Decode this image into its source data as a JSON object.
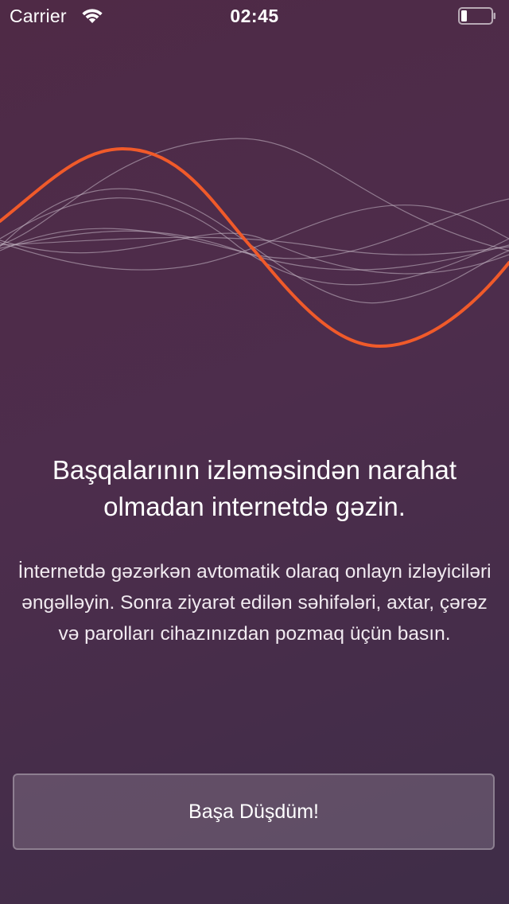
{
  "status_bar": {
    "carrier": "Carrier",
    "time": "02:45",
    "icons": {
      "wifi": "wifi-icon",
      "battery": "battery-icon"
    }
  },
  "illustration": {
    "icon": "sound-wave-icon",
    "accent_color": "#f05a2a",
    "line_color": "#c8bcc8"
  },
  "onboarding": {
    "headline": "Başqalarının izləməsindən narahat olmadan internetdə gəzin.",
    "body": "İnternetdə gəzərkən avtomatik olaraq onlayn izləyiciləri əngəlləyin. Sonra ziyarət edilən səhifələri, axtar, çərəz və parolları cihazınızdan pozmaq üçün basın.",
    "button_label": "Başa Düşdüm!"
  },
  "colors": {
    "background_start": "#4f2a46",
    "background_end": "#3f2d48",
    "text": "#ffffff"
  }
}
